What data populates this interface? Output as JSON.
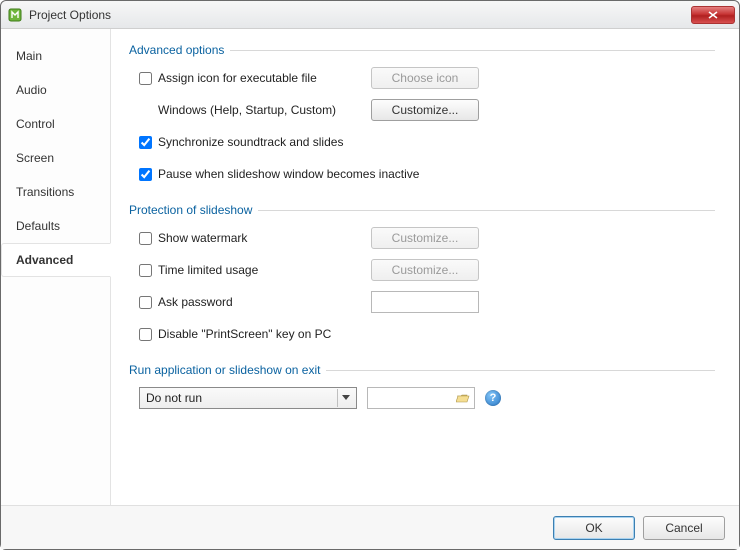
{
  "window": {
    "title": "Project Options"
  },
  "sidebar": {
    "tabs": [
      {
        "label": "Main",
        "active": false
      },
      {
        "label": "Audio",
        "active": false
      },
      {
        "label": "Control",
        "active": false
      },
      {
        "label": "Screen",
        "active": false
      },
      {
        "label": "Transitions",
        "active": false
      },
      {
        "label": "Defaults",
        "active": false
      },
      {
        "label": "Advanced",
        "active": true
      }
    ]
  },
  "groups": {
    "advanced": {
      "title": "Advanced options",
      "assign_icon_label": "Assign icon for executable file",
      "choose_icon_btn": "Choose icon",
      "windows_label": "Windows (Help, Startup, Custom)",
      "customize_btn": "Customize...",
      "sync_label": "Synchronize soundtrack and slides",
      "pause_label": "Pause when slideshow window becomes inactive"
    },
    "protection": {
      "title": "Protection of slideshow",
      "watermark_label": "Show watermark",
      "watermark_btn": "Customize...",
      "timelimit_label": "Time limited usage",
      "timelimit_btn": "Customize...",
      "password_label": "Ask password",
      "printscreen_label": "Disable \"PrintScreen\" key on PC"
    },
    "runexit": {
      "title": "Run application or slideshow on exit",
      "combo_value": "Do not run"
    }
  },
  "checks": {
    "assign_icon": false,
    "sync": true,
    "pause": true,
    "watermark": false,
    "timelimit": false,
    "password": false,
    "printscreen": false
  },
  "footer": {
    "ok": "OK",
    "cancel": "Cancel"
  }
}
